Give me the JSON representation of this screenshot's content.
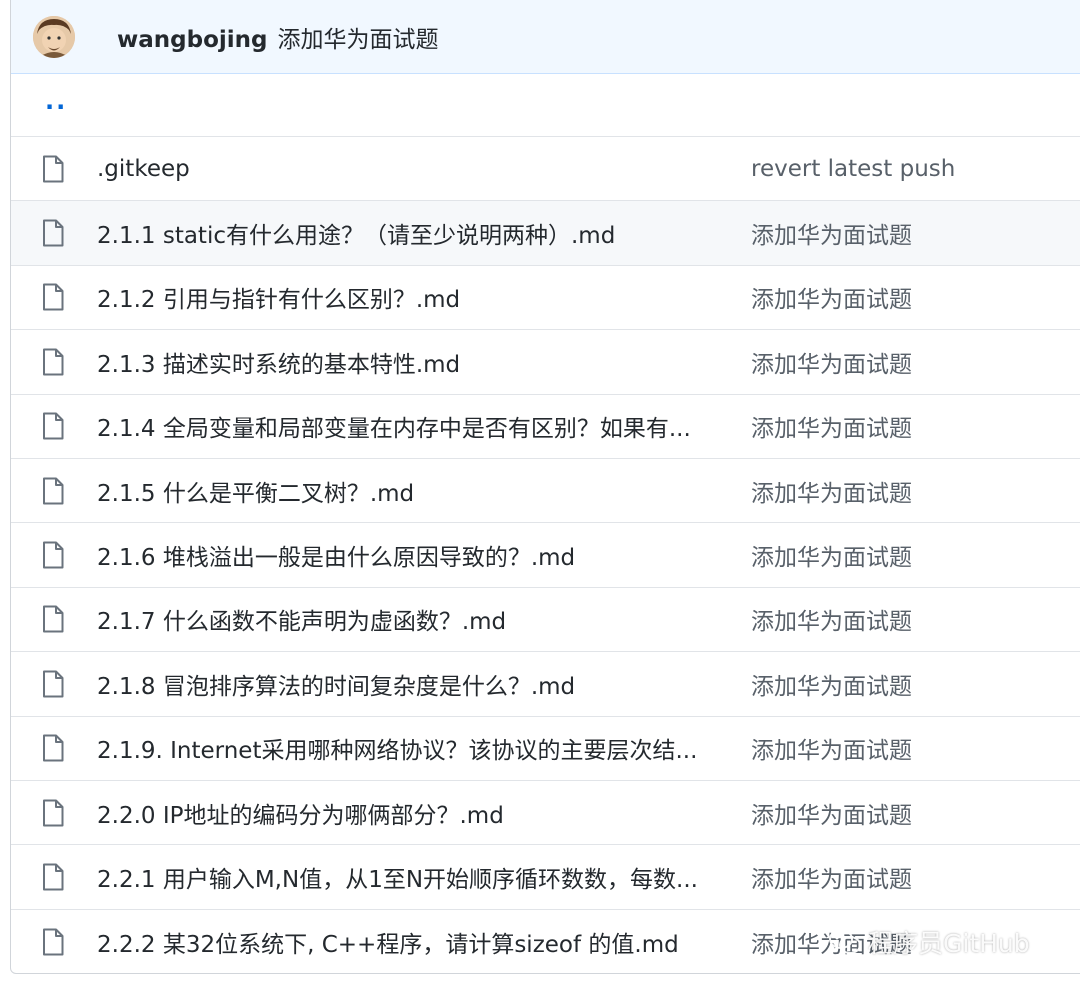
{
  "commit": {
    "author": "wangbojing",
    "message": "添加华为面试题"
  },
  "parent_link": "..",
  "files": [
    {
      "name": ".gitkeep",
      "message": "revert latest push",
      "icon": "file-icon"
    },
    {
      "name": "2.1.1 static有什么用途？（请至少说明两种）.md",
      "message": "添加华为面试题",
      "icon": "file-icon"
    },
    {
      "name": "2.1.2 引用与指针有什么区别？.md",
      "message": "添加华为面试题",
      "icon": "file-icon"
    },
    {
      "name": "2.1.3 描述实时系统的基本特性.md",
      "message": "添加华为面试题",
      "icon": "file-icon"
    },
    {
      "name": "2.1.4 全局变量和局部变量在内存中是否有区别？如果有...",
      "message": "添加华为面试题",
      "icon": "file-icon"
    },
    {
      "name": "2.1.5 什么是平衡二叉树？.md",
      "message": "添加华为面试题",
      "icon": "file-icon"
    },
    {
      "name": "2.1.6 堆栈溢出一般是由什么原因导致的？.md",
      "message": "添加华为面试题",
      "icon": "file-icon"
    },
    {
      "name": "2.1.7 什么函数不能声明为虚函数？.md",
      "message": "添加华为面试题",
      "icon": "file-icon"
    },
    {
      "name": "2.1.8 冒泡排序算法的时间复杂度是什么？.md",
      "message": "添加华为面试题",
      "icon": "file-icon"
    },
    {
      "name": "2.1.9. Internet采用哪种网络协议？该协议的主要层次结...",
      "message": "添加华为面试题",
      "icon": "file-icon"
    },
    {
      "name": "2.2.0 IP地址的编码分为哪俩部分？.md",
      "message": "添加华为面试题",
      "icon": "file-icon"
    },
    {
      "name": "2.2.1 用户输入M,N值，从1至N开始顺序循环数数，每数...",
      "message": "添加华为面试题",
      "icon": "file-icon"
    },
    {
      "name": "2.2.2 某32位系统下, C++程序，请计算sizeof 的值.md",
      "message": "添加华为面试题",
      "icon": "file-icon"
    }
  ],
  "watermark": {
    "text": "程序员GitHub",
    "icon": "wechat-icon"
  },
  "colors": {
    "link": "#0366d6",
    "header_bg": "#f1f8ff",
    "highlight_row": "#f6f8fa"
  }
}
